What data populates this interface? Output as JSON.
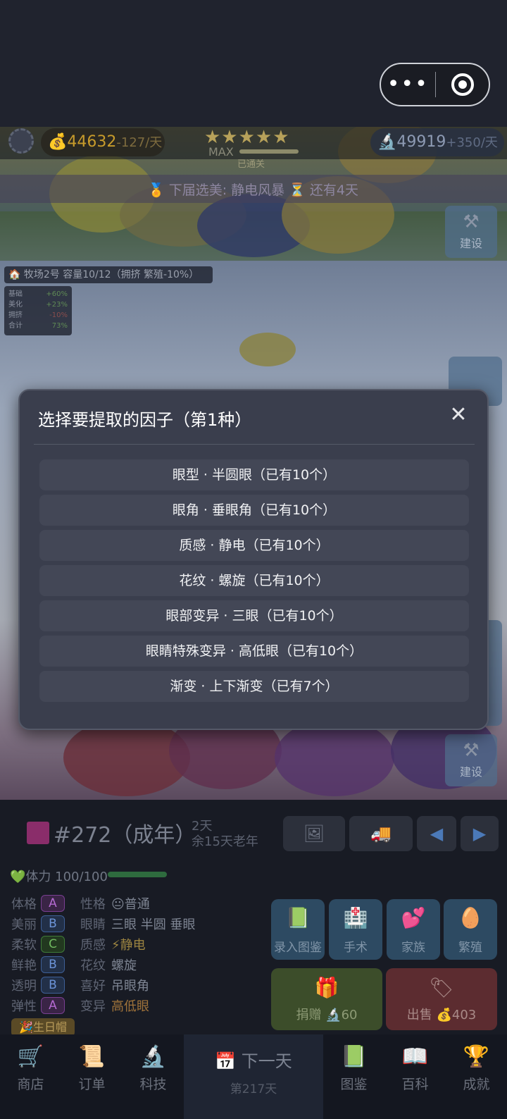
{
  "capsule": {
    "menu_icon": "more-dots-icon",
    "close_icon": "target-icon"
  },
  "hud": {
    "coins": "💰44632",
    "coins_rate": "-127/天",
    "stars": "★★★★★",
    "max_label": "MAX",
    "passed_label": "已通关",
    "gems": "🔬49919",
    "gems_rate": "+350/天",
    "notice": "🏅 下届选美: 静电风暴  ⏳ 还有4天"
  },
  "scene": {
    "build_label": "建设",
    "pasture": "🏠 牧场2号  容量10/12（拥挤 繁殖-10%）",
    "stats": [
      {
        "k": "基础",
        "v": "+60%",
        "c": "g"
      },
      {
        "k": "美化",
        "v": "+23%",
        "c": "g"
      },
      {
        "k": "拥挤",
        "v": "-10%",
        "c": "r"
      },
      {
        "k": "合计",
        "v": "73%",
        "c": "g"
      }
    ]
  },
  "modal": {
    "title": "选择要提取的因子（第1种）",
    "close": "✕",
    "options": [
      "眼型 · 半圆眼（已有10个）",
      "眼角 · 垂眼角（已有10个）",
      "质感 · 静电（已有10个）",
      "花纹 · 螺旋（已有10个）",
      "眼部变异 · 三眼（已有10个）",
      "眼睛特殊变异 · 高低眼（已有10个）",
      "渐变 · 上下渐变（已有7个）"
    ]
  },
  "pet": {
    "title": "#272（成年）",
    "age_line1": "2天",
    "age_line2": "余15天老年",
    "hp": "💚体力 100/100",
    "traits": [
      {
        "name": "体格",
        "grade": "A"
      },
      {
        "name": "美丽",
        "grade": "B"
      },
      {
        "name": "柔软",
        "grade": "C"
      },
      {
        "name": "鲜艳",
        "grade": "B"
      },
      {
        "name": "透明",
        "grade": "B"
      },
      {
        "name": "弹性",
        "grade": "A"
      }
    ],
    "attrs": [
      {
        "name": "性格",
        "value": "😐普通",
        "tone": ""
      },
      {
        "name": "眼睛",
        "value": "三眼 半圆 垂眼",
        "tone": ""
      },
      {
        "name": "质感",
        "value": "⚡静电",
        "tone": "y"
      },
      {
        "name": "花纹",
        "value": "螺旋",
        "tone": ""
      },
      {
        "name": "喜好",
        "value": "吊眼角",
        "tone": ""
      },
      {
        "name": "变异",
        "value": "高低眼",
        "tone": "o"
      }
    ],
    "birthday": "🎉生日帽"
  },
  "actions": {
    "record": "录入图鉴",
    "surgery": "手术",
    "family": "家族",
    "breed": "繁殖",
    "donate": "捐赠 🔬60",
    "sell": "出售 💰403"
  },
  "nav": {
    "shop": "商店",
    "orders": "订单",
    "tech": "科技",
    "next_day": "下一天",
    "day": "第217天",
    "atlas": "图鉴",
    "wiki": "百科",
    "achievements": "成就"
  }
}
